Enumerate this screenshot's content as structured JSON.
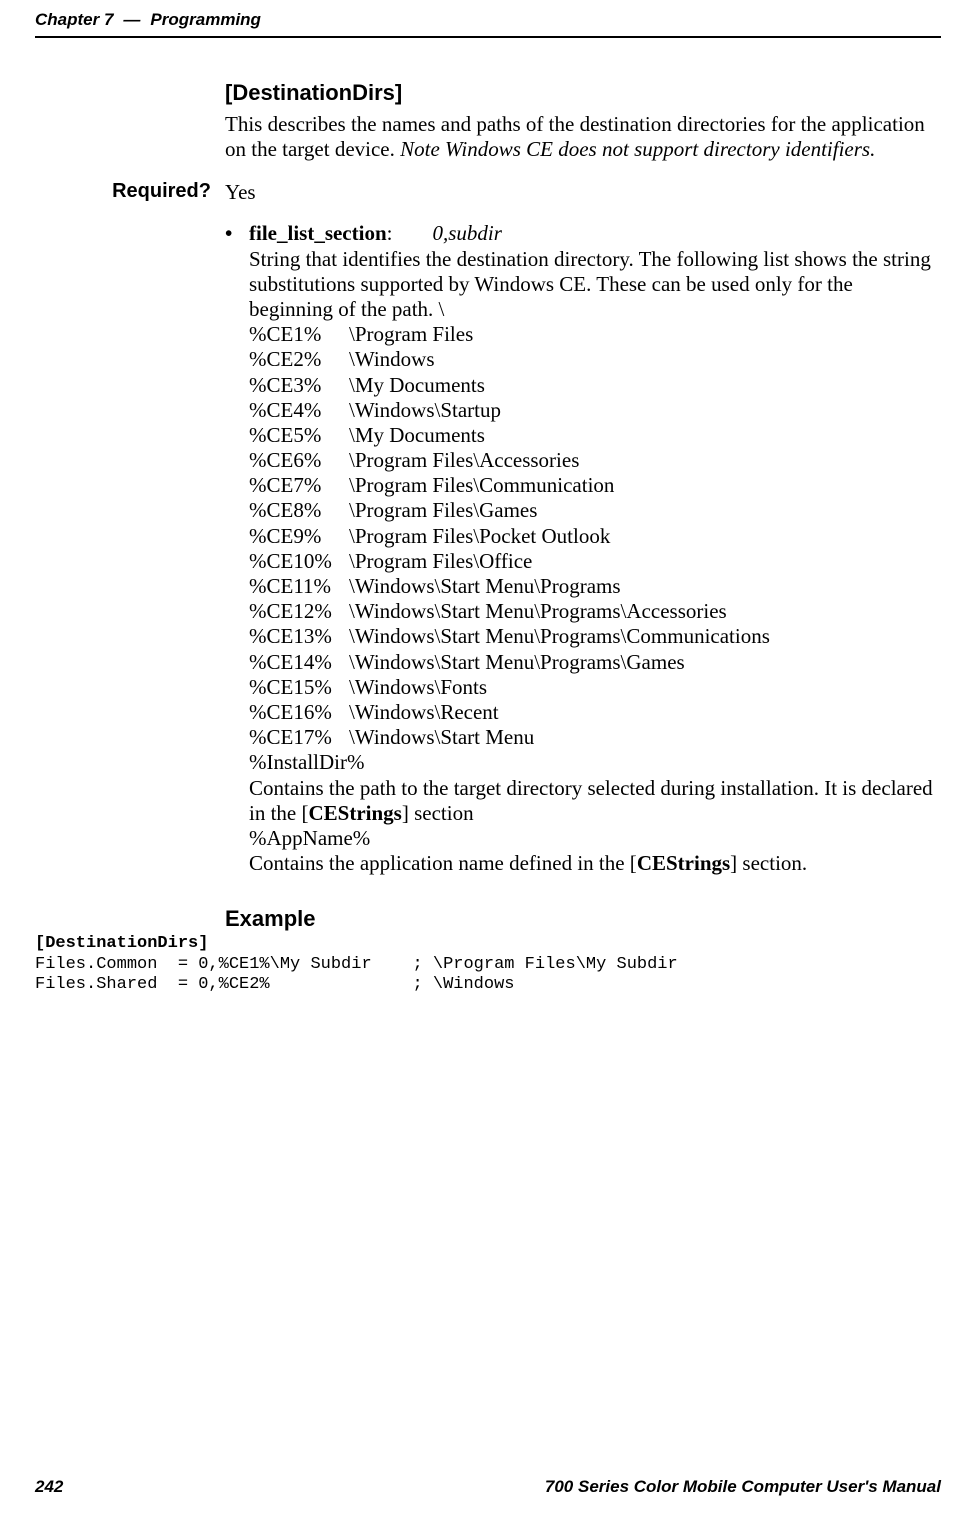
{
  "header": {
    "chapter_label": "Chapter 7",
    "separator": "—",
    "chapter_title": "Programming"
  },
  "section": {
    "title": "[DestinationDirs]",
    "desc_plain": "This describes the names and paths of the destination directories for the application on the target device. ",
    "desc_italic": "Note Windows CE does not support directory identifiers."
  },
  "required": {
    "label": "Required?",
    "value": "Yes"
  },
  "bullet": {
    "mark": "•",
    "term_bold": "file_list_section",
    "term_colon": ":",
    "term_value_italic": "0,subdir",
    "line1": "String that identifies the destination directory. The following list shows the string substitutions supported by Windows CE. These can be used only for the beginning of the path. \\",
    "paths": [
      {
        "k": "%CE1%",
        "v": "\\Program Files"
      },
      {
        "k": "%CE2%",
        "v": "\\Windows"
      },
      {
        "k": "%CE3%",
        "v": "\\My Documents"
      },
      {
        "k": "%CE4%",
        "v": "\\Windows\\Startup"
      },
      {
        "k": "%CE5%",
        "v": "\\My Documents"
      },
      {
        "k": "%CE6%",
        "v": "\\Program Files\\Accessories"
      },
      {
        "k": "%CE7%",
        "v": "\\Program Files\\Communication"
      },
      {
        "k": "%CE8%",
        "v": "\\Program Files\\Games"
      },
      {
        "k": "%CE9%",
        "v": "\\Program Files\\Pocket Outlook"
      },
      {
        "k": "%CE10%",
        "v": "\\Program Files\\Office"
      },
      {
        "k": "%CE11%",
        "v": "\\Windows\\Start Menu\\Programs"
      },
      {
        "k": "%CE12%",
        "v": "\\Windows\\Start Menu\\Programs\\Accessories"
      },
      {
        "k": "%CE13%",
        "v": "\\Windows\\Start Menu\\Programs\\Communications"
      },
      {
        "k": "%CE14%",
        "v": "\\Windows\\Start Menu\\Programs\\Games"
      },
      {
        "k": "%CE15%",
        "v": "\\Windows\\Fonts"
      },
      {
        "k": "%CE16%",
        "v": "\\Windows\\Recent"
      },
      {
        "k": "%CE17%",
        "v": "\\Windows\\Start Menu"
      }
    ],
    "installdir_key": "%InstallDir%",
    "installdir_desc_a": "Contains the path to the target directory selected during installation. It is declared in the [",
    "installdir_desc_bold": "CEStrings",
    "installdir_desc_b": "] section",
    "appname_key": "%AppName%",
    "appname_desc_a": "Contains the application name defined in the [",
    "appname_desc_bold": "CEStrings",
    "appname_desc_b": "] section."
  },
  "example": {
    "title": "Example",
    "header_bold": "[DestinationDirs]",
    "line1": "Files.Common  = 0,%CE1%\\My Subdir    ; \\Program Files\\My Subdir",
    "line2": "Files.Shared  = 0,%CE2%              ; \\Windows"
  },
  "footer": {
    "page": "242",
    "manual": "700 Series Color Mobile Computer User's Manual"
  }
}
